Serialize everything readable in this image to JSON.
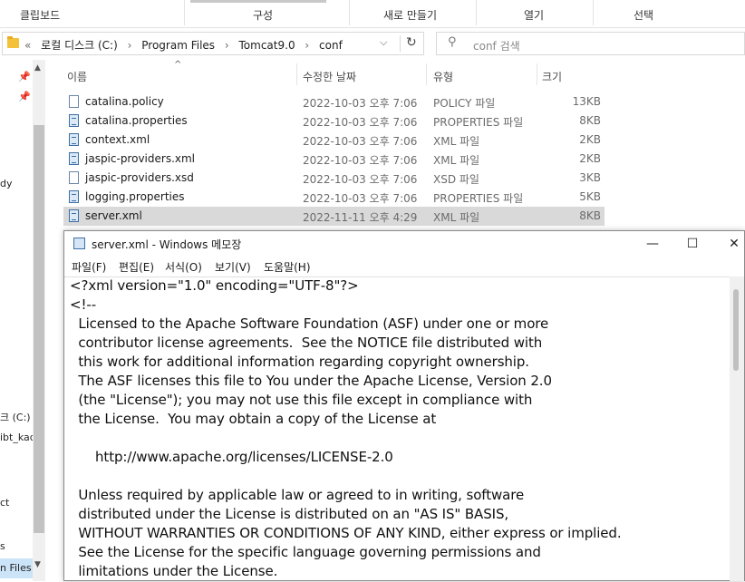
{
  "ribbon": {
    "groups": [
      "클립보드",
      "구성",
      "새로 만들기",
      "열기",
      "선택"
    ]
  },
  "address": {
    "crumbs": [
      "«",
      "로컬 디스크 (C:)",
      "›",
      "Program Files",
      "›",
      "Tomcat9.0",
      "›",
      "conf"
    ],
    "dropdown_icon": "chevron-down-icon",
    "refresh_icon": "refresh-icon"
  },
  "search": {
    "placeholder": "conf 검색",
    "icon": "search-icon"
  },
  "nav": {
    "items": [
      "dy",
      "크 (C:)",
      "ibt_kad",
      "ct",
      "s",
      "n Files"
    ]
  },
  "columns": {
    "name": "이름",
    "modified": "수정한 날짜",
    "type": "유형",
    "size": "크기"
  },
  "files": [
    {
      "name": "catalina.policy",
      "modified": "2022-10-03 오후 7:06",
      "type": "POLICY 파일",
      "size": "13KB",
      "icon": "file-icon"
    },
    {
      "name": "catalina.properties",
      "modified": "2022-10-03 오후 7:06",
      "type": "PROPERTIES 파일",
      "size": "8KB",
      "icon": "xml-file-icon"
    },
    {
      "name": "context.xml",
      "modified": "2022-10-03 오후 7:06",
      "type": "XML 파일",
      "size": "2KB",
      "icon": "xml-file-icon"
    },
    {
      "name": "jaspic-providers.xml",
      "modified": "2022-10-03 오후 7:06",
      "type": "XML 파일",
      "size": "2KB",
      "icon": "xml-file-icon"
    },
    {
      "name": "jaspic-providers.xsd",
      "modified": "2022-10-03 오후 7:06",
      "type": "XSD 파일",
      "size": "3KB",
      "icon": "file-icon"
    },
    {
      "name": "logging.properties",
      "modified": "2022-10-03 오후 7:06",
      "type": "PROPERTIES 파일",
      "size": "5KB",
      "icon": "xml-file-icon"
    },
    {
      "name": "server.xml",
      "modified": "2022-11-11 오후 4:29",
      "type": "XML 파일",
      "size": "8KB",
      "icon": "xml-file-icon",
      "selected": true
    }
  ],
  "notepad": {
    "title": "server.xml - Windows 메모장",
    "controls": {
      "minimize": "—",
      "maximize": "☐",
      "close": "✕"
    },
    "menu": [
      "파일(F)",
      "편집(E)",
      "서식(O)",
      "보기(V)",
      "도움말(H)"
    ],
    "lines": [
      "<?xml version=\"1.0\" encoding=\"UTF-8\"?>",
      "<!--",
      "  Licensed to the Apache Software Foundation (ASF) under one or more",
      "  contributor license agreements.  See the NOTICE file distributed with",
      "  this work for additional information regarding copyright ownership.",
      "  The ASF licenses this file to You under the Apache License, Version 2.0",
      "  (the \"License\"); you may not use this file except in compliance with",
      "  the License.  You may obtain a copy of the License at",
      "",
      "      http://www.apache.org/licenses/LICENSE-2.0",
      "",
      "  Unless required by applicable law or agreed to in writing, software",
      "  distributed under the License is distributed on an \"AS IS\" BASIS,",
      "  WITHOUT WARRANTIES OR CONDITIONS OF ANY KIND, either express or implied.",
      "  See the License for the specific language governing permissions and",
      "  limitations under the License."
    ]
  }
}
